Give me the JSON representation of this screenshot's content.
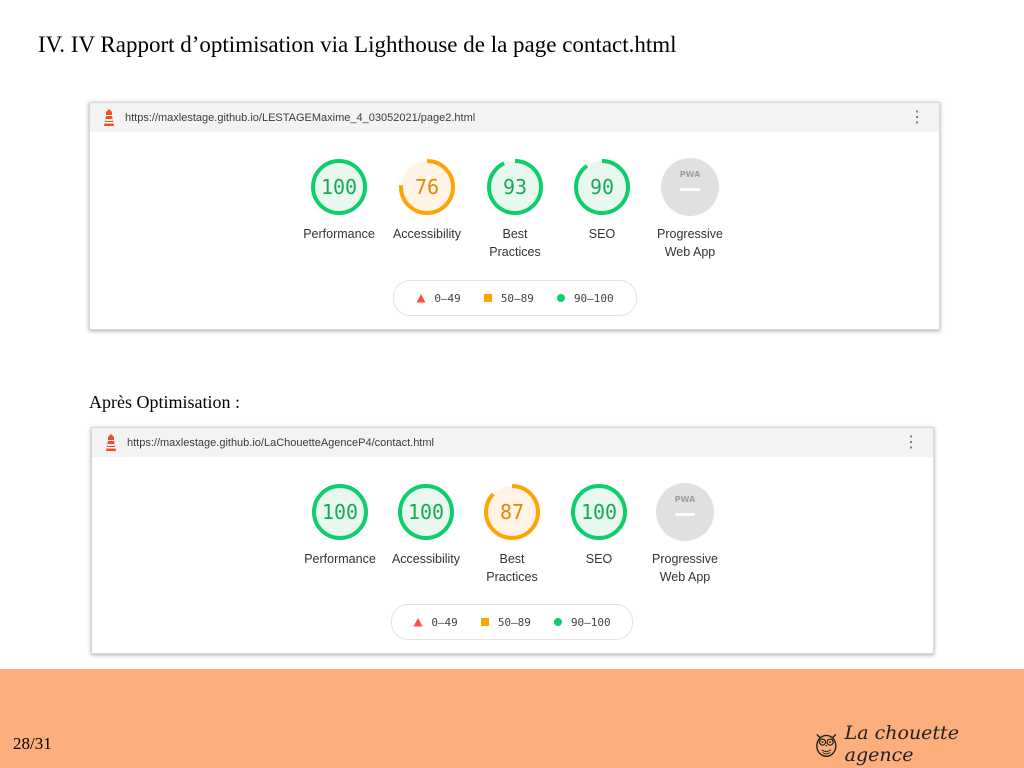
{
  "slide": {
    "title": "IV. IV Rapport d’optimisation via Lighthouse de la page contact.html",
    "subtitle": "Après Optimisation :",
    "page_number": "28/31",
    "brand_name": "La chouette agence",
    "footer_color": "#fcae7d"
  },
  "colors": {
    "good": "#0cce6b",
    "average": "#ffa400",
    "fail": "#ff4e42",
    "na": "#9e9e9e"
  },
  "report_before": {
    "url": "https://maxlestage.github.io/LESTAGEMaxime_4_03052021/page2.html",
    "menu_icon": "kebab-menu-icon",
    "gauges": [
      {
        "score": "100",
        "label": "Performance",
        "status": "good",
        "fraction": 1.0
      },
      {
        "score": "76",
        "label": "Accessibility",
        "status": "average",
        "fraction": 0.76
      },
      {
        "score": "93",
        "label": "Best Practices",
        "status": "good",
        "fraction": 0.93
      },
      {
        "score": "90",
        "label": "SEO",
        "status": "good",
        "fraction": 0.9
      }
    ],
    "pwa": {
      "badge": "PWA",
      "label": "Progressive Web App"
    },
    "legend": [
      "0–49",
      "50–89",
      "90–100"
    ]
  },
  "report_after": {
    "url": "https://maxlestage.github.io/LaChouetteAgenceP4/contact.html",
    "menu_icon": "kebab-menu-icon",
    "gauges": [
      {
        "score": "100",
        "label": "Performance",
        "status": "good",
        "fraction": 1.0
      },
      {
        "score": "100",
        "label": "Accessibility",
        "status": "good",
        "fraction": 1.0
      },
      {
        "score": "87",
        "label": "Best Practices",
        "status": "average",
        "fraction": 0.87
      },
      {
        "score": "100",
        "label": "SEO",
        "status": "good",
        "fraction": 1.0
      }
    ],
    "pwa": {
      "badge": "PWA",
      "label": "Progressive Web App"
    },
    "legend": [
      "0–49",
      "50–89",
      "90–100"
    ]
  }
}
